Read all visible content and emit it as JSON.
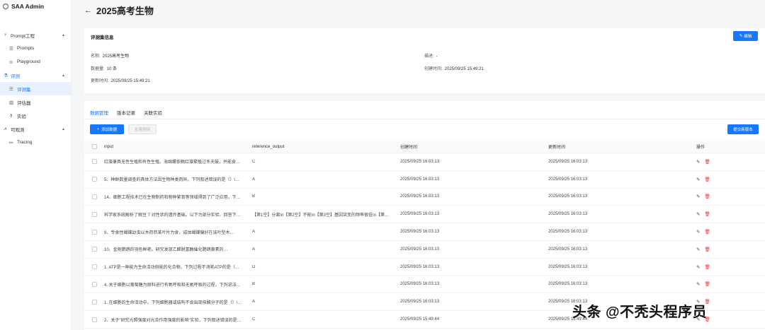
{
  "app": {
    "title": "SAA Admin"
  },
  "sidebar": {
    "groups": [
      {
        "label": "Prompt工程",
        "items": [
          {
            "label": "Prompts"
          },
          {
            "label": "Playground"
          }
        ]
      },
      {
        "label": "评测",
        "items": [
          {
            "label": "评测集"
          },
          {
            "label": "评估器"
          },
          {
            "label": "实验"
          }
        ]
      },
      {
        "label": "可观测",
        "items": [
          {
            "label": "Tracing"
          }
        ]
      }
    ]
  },
  "header": {
    "title": "2025高考生物"
  },
  "info": {
    "section_title": "评测集信息",
    "edit_label": "编辑",
    "name_label": "名称:",
    "name_value": "2025高考生物",
    "count_label": "数据量:",
    "count_value": "10 条",
    "updated_label": "更新时间:",
    "updated_value": "2025/09/25 15:49:21",
    "desc_label": "描述:",
    "desc_value": "-",
    "created_label": "创建时间:",
    "created_value": "2025/09/25 15:49:21"
  },
  "tabs": [
    {
      "label": "数据管理"
    },
    {
      "label": "版本记录"
    },
    {
      "label": "关联实验"
    }
  ],
  "toolbar": {
    "add_label": "添加数据",
    "batch_delete_label": "批量删除",
    "submit_version_label": "提交新版本"
  },
  "table": {
    "headers": {
      "input": "input",
      "reference_output": "reference_output",
      "created": "创建时间",
      "updated": "更新时间",
      "ops": "操作"
    },
    "rows": [
      {
        "input": "红藻兼具无性生殖和有性生殖。海绵螺依赖红藻繁殖过冬天鼓，并能食…",
        "ref": "C",
        "created": "2025/09/25 16:03:13",
        "updated": "2025/09/25 16:03:13"
      },
      {
        "input": "5、种群数量调查的具体方法因生物种类而异。下列叙述错误的是（）\\…",
        "ref": "A",
        "created": "2025/09/25 16:03:13",
        "updated": "2025/09/25 16:03:13"
      },
      {
        "input": "14、细胞工程技术已在生物制药和物种繁育等领域得到了广泛应用。下…",
        "ref": "B",
        "created": "2025/09/25 16:03:13",
        "updated": "2025/09/25 16:03:13"
      },
      {
        "input": "科学家系统解析了豌豆 7 对性状的遗传基础。以下为部分实验、回答下…",
        "ref": "【第1空】分离\\n【第2空】不能\\n【第3空】基因突变的频率很低\\n【第…",
        "created": "2025/09/25 16:03:13",
        "updated": "2025/09/25 16:03:13"
      },
      {
        "input": "9、专食性蝴蝶幼虫以木荷恭某叶片为食，成体蝴蝶偏好在该叶型木…",
        "ref": "A",
        "created": "2025/09/25 16:03:13",
        "updated": "2025/09/25 16:03:13"
      },
      {
        "input": "10、金刚鹦鹉的羽色鲜艳。研究发现乙醛脱氢酶催化鹦鹉黄素的…",
        "ref": "A",
        "created": "2025/09/25 16:03:13",
        "updated": "2025/09/25 16:03:13"
      },
      {
        "input": "1. ATP是一种能为生命活动供能的化合物。下列过程不消耗ATP的是（…",
        "ref": "D",
        "created": "2025/09/25 16:03:13",
        "updated": "2025/09/25 16:03:13"
      },
      {
        "input": "4. 关于细胞以葡萄糖为原料进行有氧呼吸和无氧呼吸的过程，下列说法…",
        "ref": "B",
        "created": "2025/09/25 16:03:13",
        "updated": "2025/09/25 16:03:13"
      },
      {
        "input": "1. 在细胞的生命活动中，下列细胞器或结构不会出现核酸分子的是（）\\…",
        "ref": "A",
        "created": "2025/09/25 16:03:13",
        "updated": "2025/09/25 16:03:13"
      },
      {
        "input": "2、关于\"研究光照强度对光合作用强度的影响\"实验，下列叙述错误的是…",
        "ref": "C",
        "created": "2025/09/25 15:49:44",
        "updated": "2025/09/25 15:49:44"
      }
    ]
  },
  "watermark": "头条 @不秃头程序员"
}
